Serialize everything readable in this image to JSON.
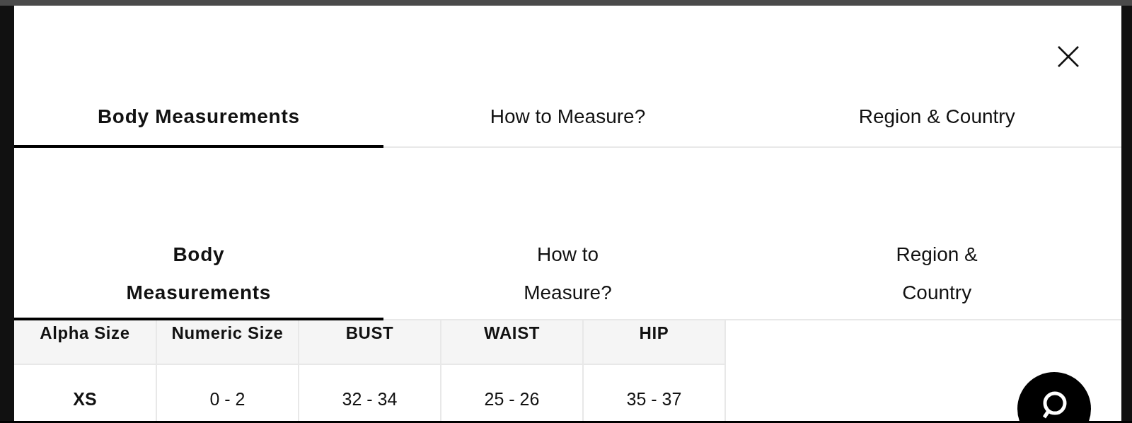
{
  "tabs": [
    {
      "label": "Body Measurements",
      "selected": true
    },
    {
      "label": "How to Measure?",
      "selected": false
    },
    {
      "label": "Region & Country",
      "selected": false
    }
  ],
  "tabs_compact": [
    {
      "label": "Body Measurements",
      "selected": true
    },
    {
      "label": "How to Measure?",
      "selected": false
    },
    {
      "label": "Region & Country",
      "selected": false
    }
  ],
  "table": {
    "columns": [
      "Alpha Size",
      "Numeric Size",
      "BUST",
      "WAIST",
      "HIP"
    ],
    "rows": [
      [
        "XS",
        "0 - 2",
        "32 - 34",
        "25 - 26",
        "35 - 37"
      ]
    ]
  }
}
